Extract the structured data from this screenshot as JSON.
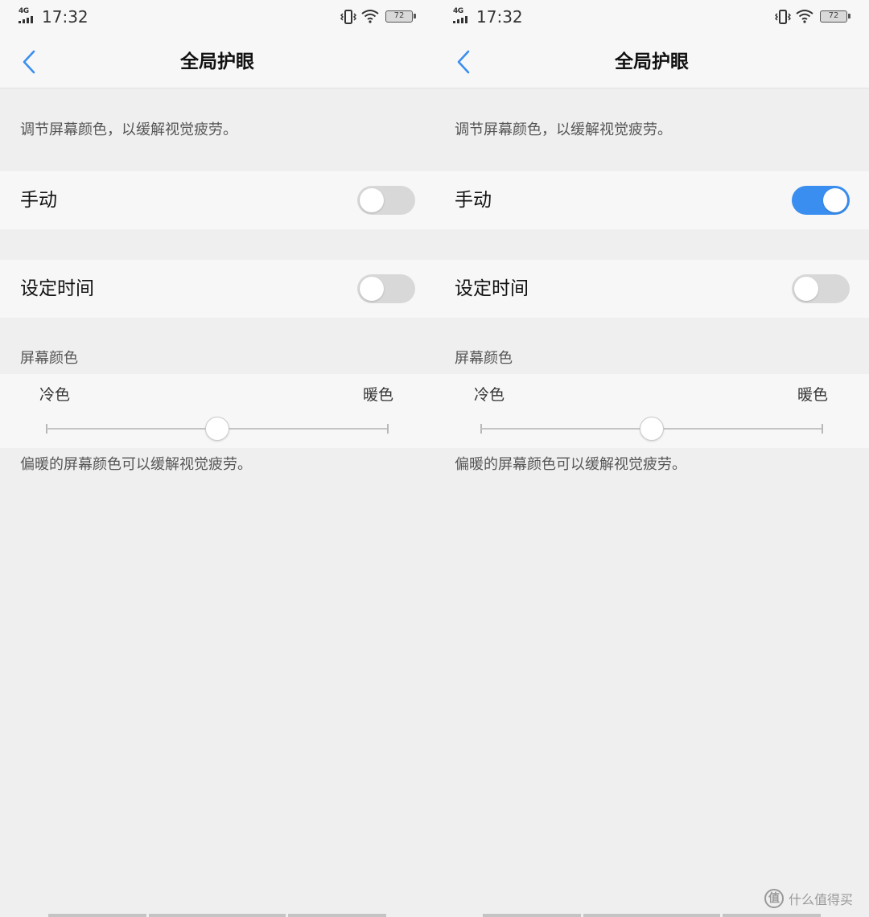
{
  "status_bar": {
    "network": "4G",
    "time": "17:32",
    "battery": "72",
    "icons": [
      "signal-icon",
      "vibrate-icon",
      "wifi-icon",
      "battery-icon"
    ]
  },
  "screens": [
    {
      "nav": {
        "title": "全局护眼",
        "back_icon": "chevron-left-icon"
      },
      "description": "调节屏幕颜色，以缓解视觉疲劳。",
      "manual": {
        "label": "手动",
        "enabled": false
      },
      "schedule": {
        "label": "设定时间",
        "enabled": false
      },
      "screen_color": {
        "section_title": "屏幕颜色",
        "left_label": "冷色",
        "right_label": "暖色",
        "level": 0.5,
        "hint": "偏暖的屏幕颜色可以缓解视觉疲劳。"
      }
    },
    {
      "nav": {
        "title": "全局护眼",
        "back_icon": "chevron-left-icon"
      },
      "description": "调节屏幕颜色，以缓解视觉疲劳。",
      "manual": {
        "label": "手动",
        "enabled": true
      },
      "schedule": {
        "label": "设定时间",
        "enabled": false
      },
      "screen_color": {
        "section_title": "屏幕颜色",
        "left_label": "冷色",
        "right_label": "暖色",
        "level": 0.5,
        "hint": "偏暖的屏幕颜色可以缓解视觉疲劳。"
      }
    }
  ],
  "colors": {
    "accent": "#3a8ef0",
    "switch_off": "#d8d8d8",
    "background": "#efefef",
    "card": "#f7f7f7"
  },
  "watermark": {
    "text": "什么值得买",
    "logo_char": "值"
  }
}
